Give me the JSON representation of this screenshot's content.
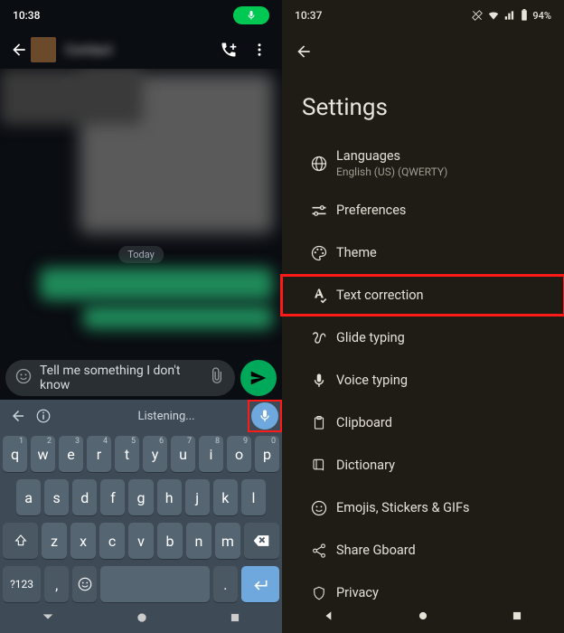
{
  "left": {
    "status_time": "10:38",
    "chat_name": "Contact",
    "day_label": "Today",
    "input_text": "Tell me something I don't know",
    "keyboard": {
      "listening": "Listening...",
      "row1": [
        "q",
        "w",
        "e",
        "r",
        "t",
        "y",
        "u",
        "i",
        "o",
        "p"
      ],
      "row1_sup": [
        "1",
        "2",
        "3",
        "4",
        "5",
        "6",
        "7",
        "8",
        "9",
        "0"
      ],
      "row2": [
        "a",
        "s",
        "d",
        "f",
        "g",
        "h",
        "j",
        "k",
        "l"
      ],
      "row3": [
        "z",
        "x",
        "c",
        "v",
        "b",
        "n",
        "m"
      ],
      "sym_label": "?123",
      "comma": ",",
      "period": "."
    }
  },
  "right": {
    "status_time": "10:37",
    "battery": "94%",
    "title": "Settings",
    "items": [
      {
        "label": "Languages",
        "sub": "English (US) (QWERTY)"
      },
      {
        "label": "Preferences"
      },
      {
        "label": "Theme"
      },
      {
        "label": "Text correction"
      },
      {
        "label": "Glide typing"
      },
      {
        "label": "Voice typing"
      },
      {
        "label": "Clipboard"
      },
      {
        "label": "Dictionary"
      },
      {
        "label": "Emojis, Stickers & GIFs"
      },
      {
        "label": "Share Gboard"
      },
      {
        "label": "Privacy"
      }
    ]
  }
}
